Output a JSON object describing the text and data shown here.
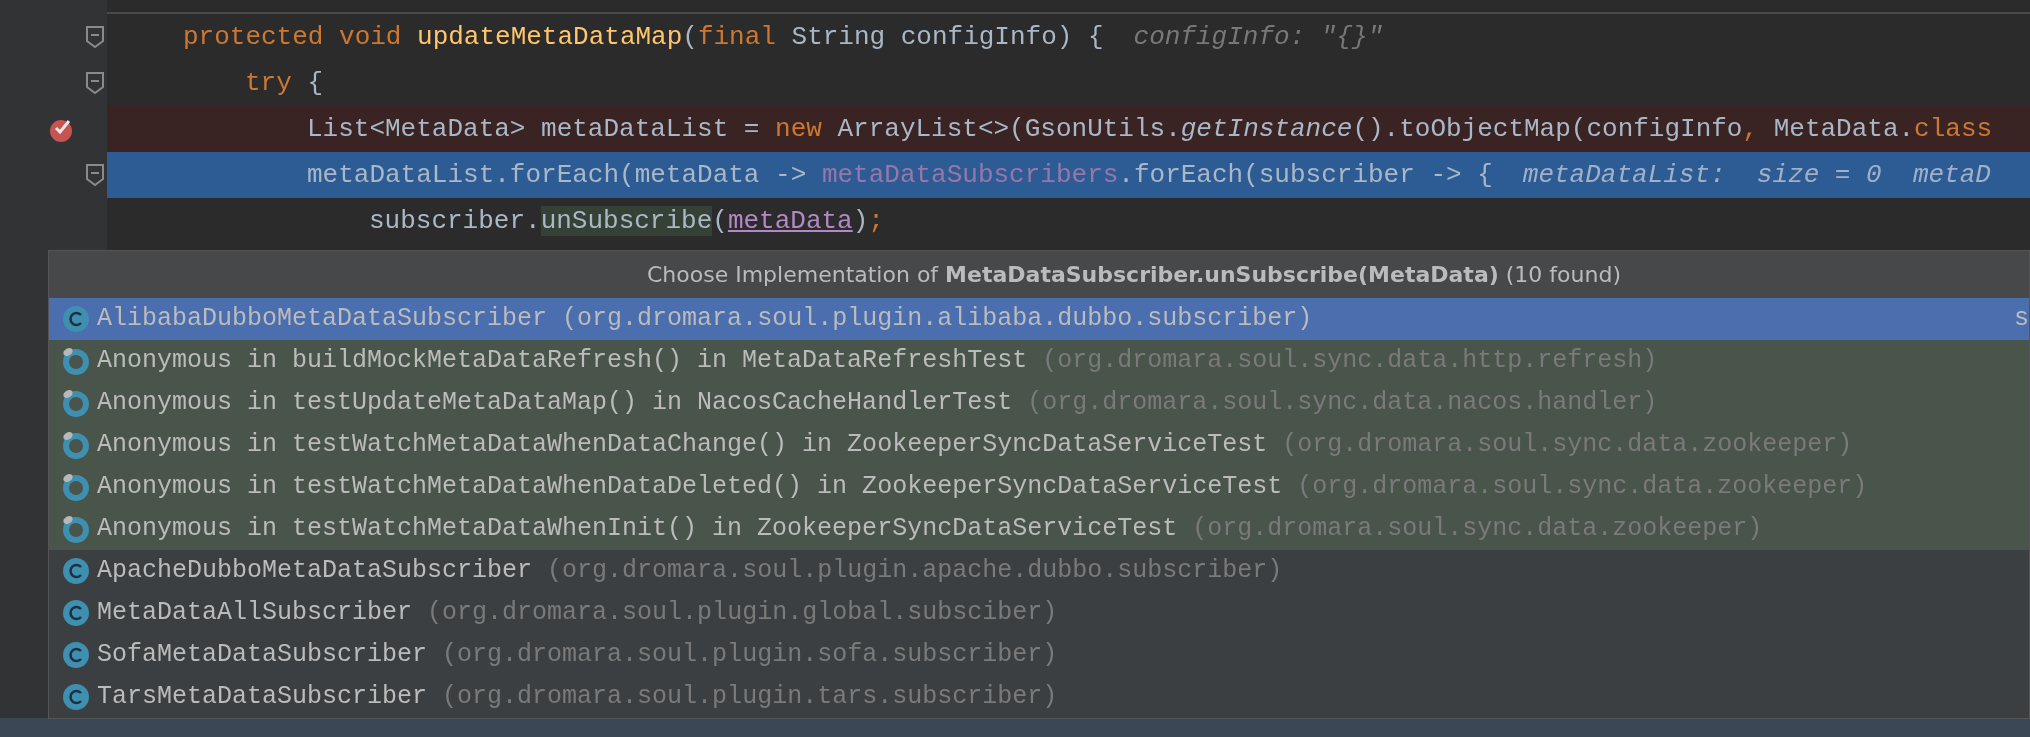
{
  "editor": {
    "lines": [
      {
        "fold": true,
        "breakpoint": false,
        "current": false,
        "tokens": [
          {
            "kind": "keyword",
            "text": "protected void "
          },
          {
            "kind": "decl",
            "text": "updateMetaDataMap"
          },
          {
            "kind": "plain",
            "text": "("
          },
          {
            "kind": "keyword",
            "text": "final"
          },
          {
            "kind": "plain",
            "text": " String configInfo) {"
          }
        ],
        "hint": "configInfo: \"{}\"",
        "children": [
          {
            "fold": true,
            "breakpoint": false,
            "current": false,
            "tokens": [
              {
                "kind": "keyword",
                "text": "try"
              },
              {
                "kind": "plain",
                "text": " {"
              }
            ],
            "children": [
              {
                "fold": false,
                "breakpoint": true,
                "current": false,
                "tokens": [
                  {
                    "kind": "plain",
                    "text": "List<MetaData> metaDataList = "
                  },
                  {
                    "kind": "keyword",
                    "text": "new"
                  },
                  {
                    "kind": "plain",
                    "text": " ArrayList<>(GsonUtils."
                  },
                  {
                    "kind": "italic",
                    "text": "getInstance"
                  },
                  {
                    "kind": "plain",
                    "text": "().toObjectMap(configInfo"
                  },
                  {
                    "kind": "keyword",
                    "text": ","
                  },
                  {
                    "kind": "plain",
                    "text": " MetaData."
                  },
                  {
                    "kind": "keyword",
                    "text": "class"
                  }
                ]
              },
              {
                "fold": true,
                "breakpoint": false,
                "current": true,
                "tokens": [
                  {
                    "kind": "plain",
                    "text": "metaDataList.forEach(metaData -> "
                  },
                  {
                    "kind": "field",
                    "text": "metaDataSubscribers"
                  },
                  {
                    "kind": "plain",
                    "text": ".forEach(subscriber -> {"
                  }
                ],
                "hint": "metaDataList:  size = 0  metaD",
                "children": [
                  {
                    "fold": false,
                    "breakpoint": false,
                    "current": false,
                    "tokens": [
                      {
                        "kind": "plain",
                        "text": "subscriber."
                      },
                      {
                        "kind": "usage",
                        "text": "unSubscribe"
                      },
                      {
                        "kind": "plain",
                        "text": "("
                      },
                      {
                        "kind": "reference",
                        "text": "metaData"
                      },
                      {
                        "kind": "plain",
                        "text": ")"
                      },
                      {
                        "kind": "keyword",
                        "text": ";"
                      }
                    ]
                  }
                ]
              }
            ]
          }
        ]
      }
    ]
  },
  "popup": {
    "title": "Choose Implementation of **MetaDataSubscriber.unSubscribe(MetaData)** (10 found)",
    "items": [
      {
        "kind": "class",
        "test": false,
        "selected": true,
        "name": "AlibabaDubboMetaDataSubscriber",
        "package": "(org.dromara.soul.plugin.alibaba.dubbo.subscriber)",
        "column_2": "s"
      },
      {
        "kind": "anonymous",
        "test": true,
        "selected": false,
        "name": "Anonymous in buildMockMetaDataRefresh() in MetaDataRefreshTest",
        "package": "(org.dromara.soul.sync.data.http.refresh)"
      },
      {
        "kind": "anonymous",
        "test": true,
        "selected": false,
        "name": "Anonymous in testUpdateMetaDataMap() in NacosCacheHandlerTest",
        "package": "(org.dromara.soul.sync.data.nacos.handler)"
      },
      {
        "kind": "anonymous",
        "test": true,
        "selected": false,
        "name": "Anonymous in testWatchMetaDataWhenDataChange() in ZookeeperSyncDataServiceTest",
        "package": "(org.dromara.soul.sync.data.zookeeper)"
      },
      {
        "kind": "anonymous",
        "test": true,
        "selected": false,
        "name": "Anonymous in testWatchMetaDataWhenDataDeleted() in ZookeeperSyncDataServiceTest",
        "package": "(org.dromara.soul.sync.data.zookeeper)"
      },
      {
        "kind": "anonymous",
        "test": true,
        "selected": false,
        "name": "Anonymous in testWatchMetaDataWhenInit() in ZookeeperSyncDataServiceTest",
        "package": "(org.dromara.soul.sync.data.zookeeper)"
      },
      {
        "kind": "class",
        "test": false,
        "selected": false,
        "name": "ApacheDubboMetaDataSubscriber",
        "package": "(org.dromara.soul.plugin.apache.dubbo.subscriber)"
      },
      {
        "kind": "class",
        "test": false,
        "selected": false,
        "name": "MetaDataAllSubscriber",
        "package": "(org.dromara.soul.plugin.global.subsciber)"
      },
      {
        "kind": "class",
        "test": false,
        "selected": false,
        "name": "SofaMetaDataSubscriber",
        "package": "(org.dromara.soul.plugin.sofa.subscriber)"
      },
      {
        "kind": "class",
        "test": false,
        "selected": false,
        "name": "TarsMetaDataSubscriber",
        "package": "(org.dromara.soul.plugin.tars.subscriber)"
      }
    ]
  }
}
